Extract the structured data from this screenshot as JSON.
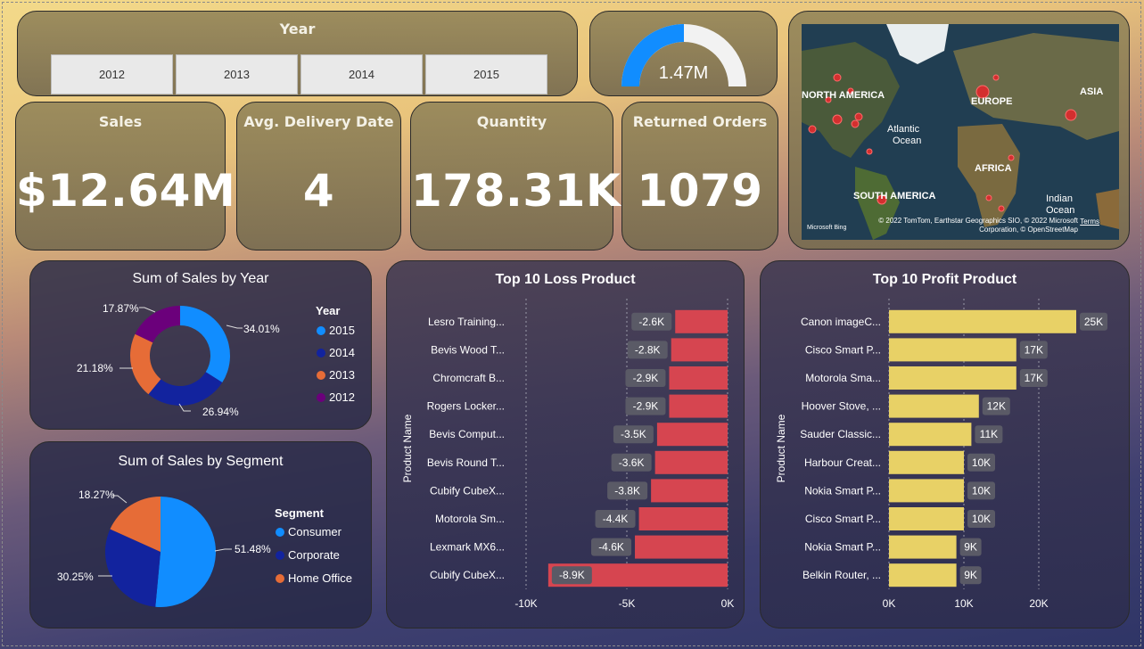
{
  "slicer": {
    "title": "Year",
    "options": [
      "2012",
      "2013",
      "2014",
      "2015"
    ]
  },
  "gauge": {
    "value_label": "1.47M",
    "fill_fraction": 0.5
  },
  "map": {
    "labels": [
      "NORTH AMERICA",
      "EUROPE",
      "ASIA",
      "Atlantic Ocean",
      "AFRICA",
      "SOUTH AMERICA",
      "Indian Ocean"
    ],
    "brand": "Microsoft Bing",
    "attribution": "© 2022 TomTom, Earthstar Geographics SIO, © 2022 Microsoft Corporation, © OpenStreetMap",
    "terms": "Terms"
  },
  "kpis": {
    "sales": {
      "label": "Sales",
      "value": "$12.64M"
    },
    "delivery": {
      "label": "Avg. Delivery Date",
      "value": "4"
    },
    "quantity": {
      "label": "Quantity",
      "value": "178.31K"
    },
    "returned": {
      "label": "Returned Orders",
      "value": "1079"
    }
  },
  "colors": {
    "y2015": "#118dff",
    "y2014": "#12239e",
    "y2013": "#e66c37",
    "y2012": "#6b007b",
    "loss_bar": "#d64550",
    "profit_bar": "#e8d166"
  },
  "chart_data": [
    {
      "type": "pie",
      "title": "Sum of Sales by Year",
      "legend_title": "Year",
      "legend_placement": "right",
      "donut": true,
      "categories": [
        "2015",
        "2014",
        "2013",
        "2012"
      ],
      "values": [
        34.01,
        26.94,
        21.18,
        17.87
      ],
      "labels": [
        "34.01%",
        "26.94%",
        "21.18%",
        "17.87%"
      ]
    },
    {
      "type": "pie",
      "title": "Sum of Sales by Segment",
      "legend_title": "Segment",
      "legend_placement": "right",
      "donut": false,
      "categories": [
        "Consumer",
        "Corporate",
        "Home Office"
      ],
      "values": [
        51.48,
        30.25,
        18.27
      ],
      "labels": [
        "51.48%",
        "30.25%",
        "18.27%"
      ]
    },
    {
      "type": "bar",
      "orientation": "horizontal",
      "title": "Top 10 Loss Product",
      "ylabel": "Product Name",
      "categories": [
        "Lesro Training...",
        "Bevis Wood T...",
        "Chromcraft B...",
        "Rogers Locker...",
        "Bevis Comput...",
        "Bevis Round T...",
        "Cubify CubeX...",
        "Motorola Sm...",
        "Lexmark MX6...",
        "Cubify CubeX..."
      ],
      "values": [
        -2600,
        -2800,
        -2900,
        -2900,
        -3500,
        -3600,
        -3800,
        -4400,
        -4600,
        -8900
      ],
      "data_labels": [
        "-2.6K",
        "-2.8K",
        "-2.9K",
        "-2.9K",
        "-3.5K",
        "-3.6K",
        "-3.8K",
        "-4.4K",
        "-4.6K",
        "-8.9K"
      ],
      "xlim": [
        -10000,
        0
      ],
      "x_ticks": [
        "-10K",
        "-5K",
        "0K"
      ]
    },
    {
      "type": "bar",
      "orientation": "horizontal",
      "title": "Top 10 Profit Product",
      "ylabel": "Product Name",
      "categories": [
        "Canon imageC...",
        "Cisco Smart P...",
        "Motorola Sma...",
        "Hoover Stove, ...",
        "Sauder Classic...",
        "Harbour Creat...",
        "Nokia Smart P...",
        "Cisco Smart P...",
        "Nokia Smart P...",
        "Belkin Router, ..."
      ],
      "values": [
        25000,
        17000,
        17000,
        12000,
        11000,
        10000,
        10000,
        10000,
        9000,
        9000
      ],
      "data_labels": [
        "25K",
        "17K",
        "17K",
        "12K",
        "11K",
        "10K",
        "10K",
        "10K",
        "9K",
        "9K"
      ],
      "xlim": [
        0,
        25000
      ],
      "x_ticks": [
        "0K",
        "10K",
        "20K"
      ]
    }
  ]
}
